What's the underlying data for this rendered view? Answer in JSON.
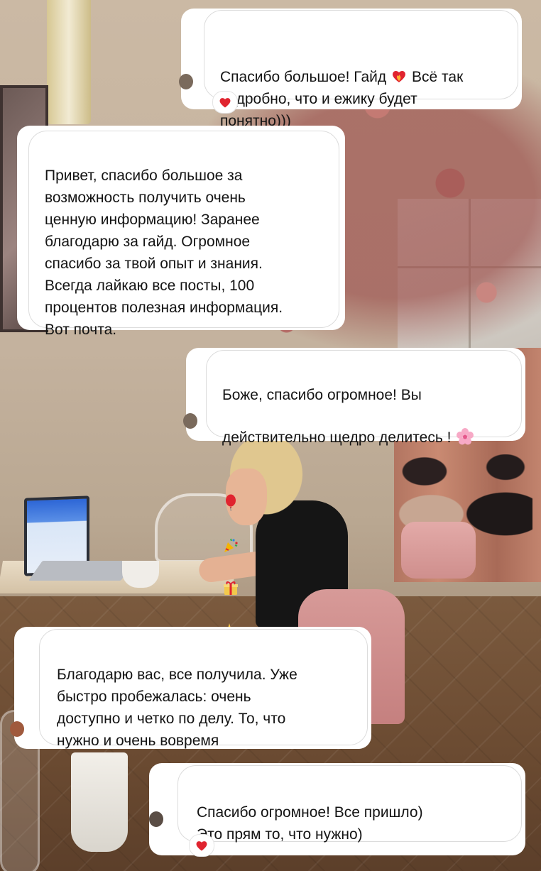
{
  "messages": [
    {
      "id": "msg1",
      "text": "Спасибо большое! Гайд",
      "text_after_icon": " Всё так\nподробно, что и ежику будет\nпонятно)))",
      "inline_icon": "heart-on-fire-icon",
      "reaction": "red-heart-icon"
    },
    {
      "id": "msg2",
      "text": "Привет, спасибо большое за\nвозможность получить очень\nценную информацию! Заранее\nблагодарю за гайд. Огромное\nспасибо за твой опыт и знания.\nВсегда лайкаю все посты, 100\nпроцентов полезная информация.\nВот почта."
    },
    {
      "id": "msg3",
      "text": "Боже, спасибо огромное! Вы\nдействительно щедро делитесь !",
      "emoji_icons": [
        "cherry-blossom-icon",
        "balloon-icon",
        "party-popper-icon",
        "wrapped-gift-icon",
        "sparkles-icon"
      ]
    },
    {
      "id": "msg4",
      "text": "Благодарю вас, все получила. Уже\nбыстро пробежалась: очень\nдоступно и четко по делу. То, что\nнужно и очень вовремя"
    },
    {
      "id": "msg5",
      "text": "Спасибо огромное! Все пришло)\nЭто прям то, что нужно)",
      "reaction": "red-heart-icon"
    }
  ],
  "colors": {
    "bubble_bg": "#ffffff",
    "bubble_border": "#dcdcdc",
    "text": "#141414",
    "heart": "#e0242f"
  }
}
